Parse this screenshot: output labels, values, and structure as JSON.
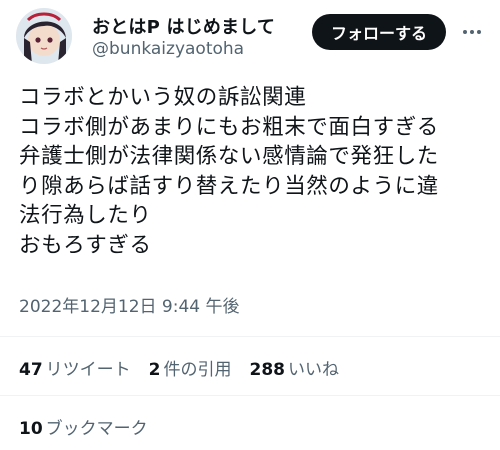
{
  "author": {
    "display_name": "おとはP はじめまして",
    "handle": "@bunkaizyaotoha"
  },
  "follow_button_label": "フォローする",
  "more_icon": "more-horizontal-icon",
  "tweet_lines": [
    "コラボとかいう奴の訴訟関連",
    "コラボ側があまりにもお粗末で面白すぎる",
    "弁護士側が法律関係ない感情論で発狂した",
    "り隙あらば話すり替えたり当然のように違",
    "法行為したり",
    "おもろすぎる"
  ],
  "timestamp": "2022年12月12日 9:44 午後",
  "stats": {
    "retweets_count": "47",
    "retweets_label": "リツイート",
    "quotes_count": "2",
    "quotes_label": "件の引用",
    "likes_count": "288",
    "likes_label": "いいね",
    "bookmarks_count": "10",
    "bookmarks_label": "ブックマーク"
  },
  "colors": {
    "text_primary": "#0f1419",
    "text_secondary": "#536471",
    "divider": "#eff3f4",
    "button_bg": "#0f1419",
    "button_text": "#ffffff"
  }
}
